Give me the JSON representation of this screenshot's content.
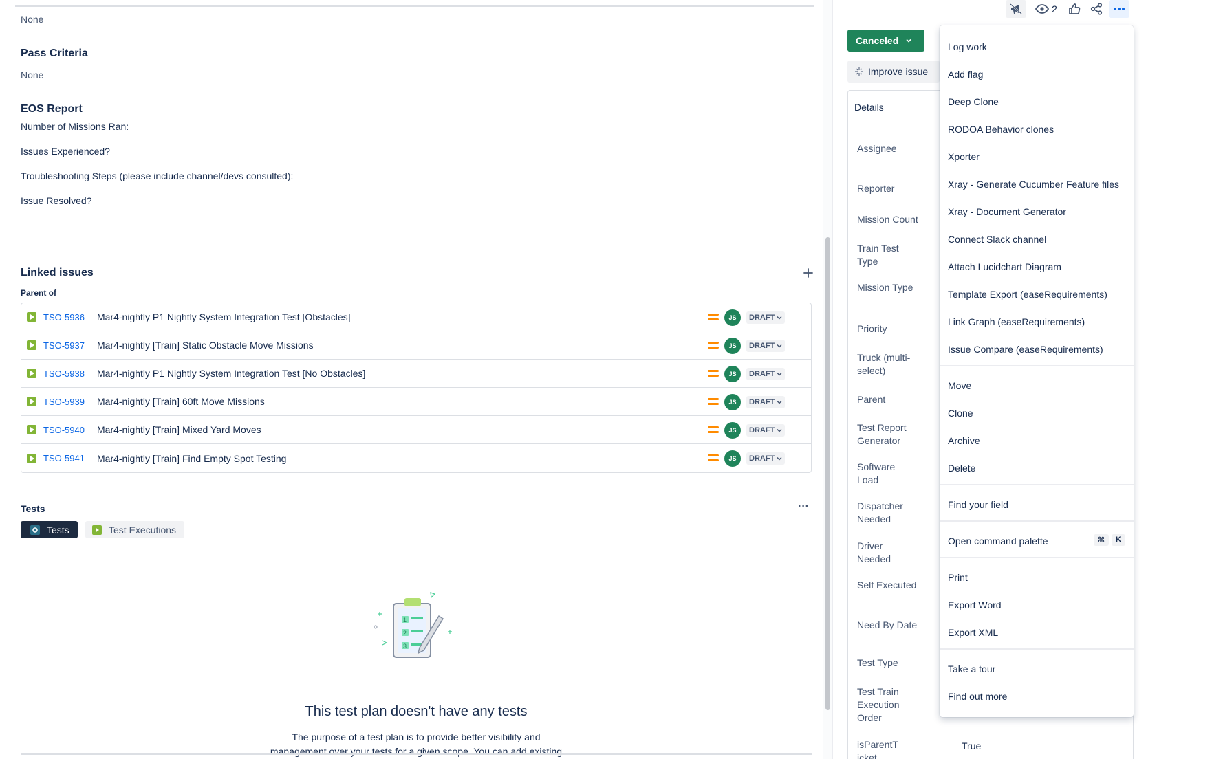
{
  "left": {
    "top_value": "None",
    "pass_criteria": {
      "title": "Pass Criteria",
      "value": "None"
    },
    "eos_report": {
      "title": "EOS Report",
      "lines": [
        "Number of Missions Ran:",
        "Issues Experienced?",
        "Troubleshooting Steps (please include channel/devs consulted):",
        "Issue Resolved?"
      ]
    },
    "linked_issues": {
      "title": "Linked issues",
      "add_icon": "plus-icon",
      "relation": "Parent of",
      "rows": [
        {
          "key": "TSO-5936",
          "summary": "Mar4-nightly P1 Nightly System Integration Test [Obstacles]",
          "avatar": "JS",
          "status": "DRAFT"
        },
        {
          "key": "TSO-5937",
          "summary": "Mar4-nightly [Train] Static Obstacle Move Missions",
          "avatar": "JS",
          "status": "DRAFT"
        },
        {
          "key": "TSO-5938",
          "summary": "Mar4-nightly P1 Nightly System Integration Test [No Obstacles]",
          "avatar": "JS",
          "status": "DRAFT"
        },
        {
          "key": "TSO-5939",
          "summary": "Mar4-nightly [Train] 60ft Move Missions",
          "avatar": "JS",
          "status": "DRAFT"
        },
        {
          "key": "TSO-5940",
          "summary": "Mar4-nightly [Train] Mixed Yard Moves",
          "avatar": "JS",
          "status": "DRAFT"
        },
        {
          "key": "TSO-5941",
          "summary": "Mar4-nightly [Train] Find Empty Spot Testing",
          "avatar": "JS",
          "status": "DRAFT"
        }
      ]
    },
    "tests": {
      "title": "Tests",
      "more_label": "···",
      "tab_tests": "Tests",
      "tab_executions": "Test Executions",
      "empty_title": "This test plan doesn't have any tests",
      "empty_line1": "The purpose of a test plan is to provide better visibility and",
      "empty_line2": "management over your tests for a given scope. You can add existing"
    }
  },
  "right": {
    "watchers_count": "2",
    "status_label": "Canceled",
    "improve_label": "Improve issue",
    "details_label": "Details",
    "fields": [
      "Assignee",
      "Reporter",
      "Mission Count",
      "Train Test Type",
      "Mission Type",
      "Priority",
      "Truck (multi-select)",
      "Parent",
      "Test Report Generator",
      "Software Load",
      "Dispatcher Needed",
      "Driver Needed",
      "Self Executed",
      "Need By Date",
      "Test Type",
      "Test Train Execution Order",
      "isParentTicket"
    ],
    "is_parent_value": "True"
  },
  "menu": {
    "items": [
      "Log work",
      "Add flag",
      "Deep Clone",
      "RODOA Behavior clones",
      "Xporter",
      "Xray - Generate Cucumber Feature files",
      "Xray - Document Generator",
      "Connect Slack channel",
      "Attach Lucidchart Diagram",
      "Template Export (easeRequirements)",
      "Link Graph (easeRequirements)",
      "Issue Compare (easeRequirements)",
      "Move",
      "Clone",
      "Archive",
      "Delete",
      "Find your field",
      "Open command palette",
      "Print",
      "Export Word",
      "Export XML",
      "Take a tour",
      "Find out more"
    ],
    "shortcut_keys": [
      "⌘",
      "K"
    ]
  },
  "colors": {
    "accent_green": "#1f845a",
    "link_blue": "#0c66e4",
    "priority_orange": "#ff8b00",
    "story_green": "#82b536"
  }
}
